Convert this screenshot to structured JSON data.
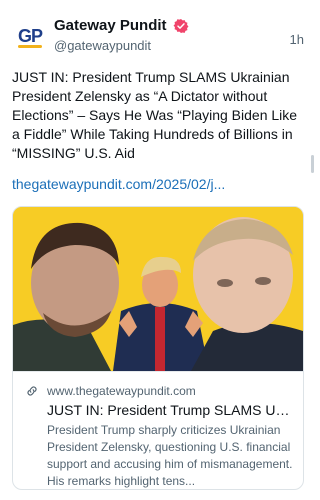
{
  "account": {
    "name": "Gateway Pundit",
    "handle": "@gatewaypundit",
    "time": "1h",
    "avatar_text": "GP"
  },
  "post": {
    "text": "JUST IN: President Trump SLAMS Ukrainian President Zelensky as “A Dictator without Elections” – Says He Was “Playing Biden Like a Fiddle” While Taking Hundreds of Billions in “MISSING” U.S. Aid",
    "link": "thegatewaypundit.com/2025/02/j..."
  },
  "link_card": {
    "domain": "www.thegatewaypundit.com",
    "title": "JUST IN: President Trump SLAMS Ukr...",
    "description": "President Trump sharply criticizes Ukrainian President Zelensky, questioning U.S. financial support and accusing him of mismanagement. His remarks highlight tens..."
  },
  "colors": {
    "link": "#1b6fb8",
    "verified_badge": "#f0446b",
    "card_image_background": "#f7cc25",
    "secondary_text": "#536471"
  },
  "icons": {
    "verified": "verified-badge-icon",
    "link": "link-chain-icon"
  }
}
